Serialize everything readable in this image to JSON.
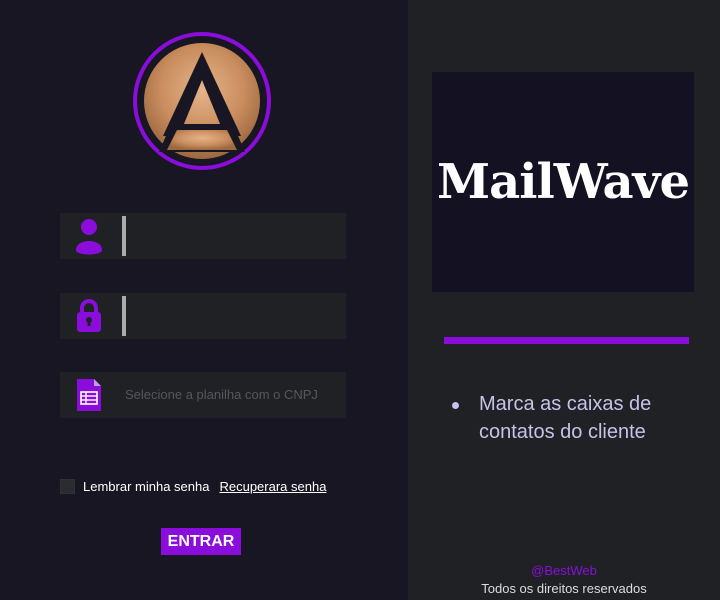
{
  "login": {
    "username_placeholder": "",
    "password_placeholder": "",
    "file_placeholder": "Selecione a planilha com o CNPJ",
    "remember_label": "Lembrar minha senha",
    "recover_link": "Recuperara senha",
    "submit_label": "ENTRAR"
  },
  "brand": {
    "title": "MailWave",
    "features": [
      "Marca as caixas de contatos do cliente"
    ]
  },
  "footer": {
    "handle": "@BestWeb",
    "rights": "Todos os direitos reservados"
  },
  "icons": [
    "logo-icon",
    "user-icon",
    "lock-icon",
    "spreadsheet-icon"
  ],
  "colors": {
    "accent": "#8b0ddb",
    "left_background": "#191623",
    "right_background": "#1f2124",
    "field_background": "#1f2124",
    "brand_card": "#141122",
    "feature_text": "#c7c2ea"
  }
}
